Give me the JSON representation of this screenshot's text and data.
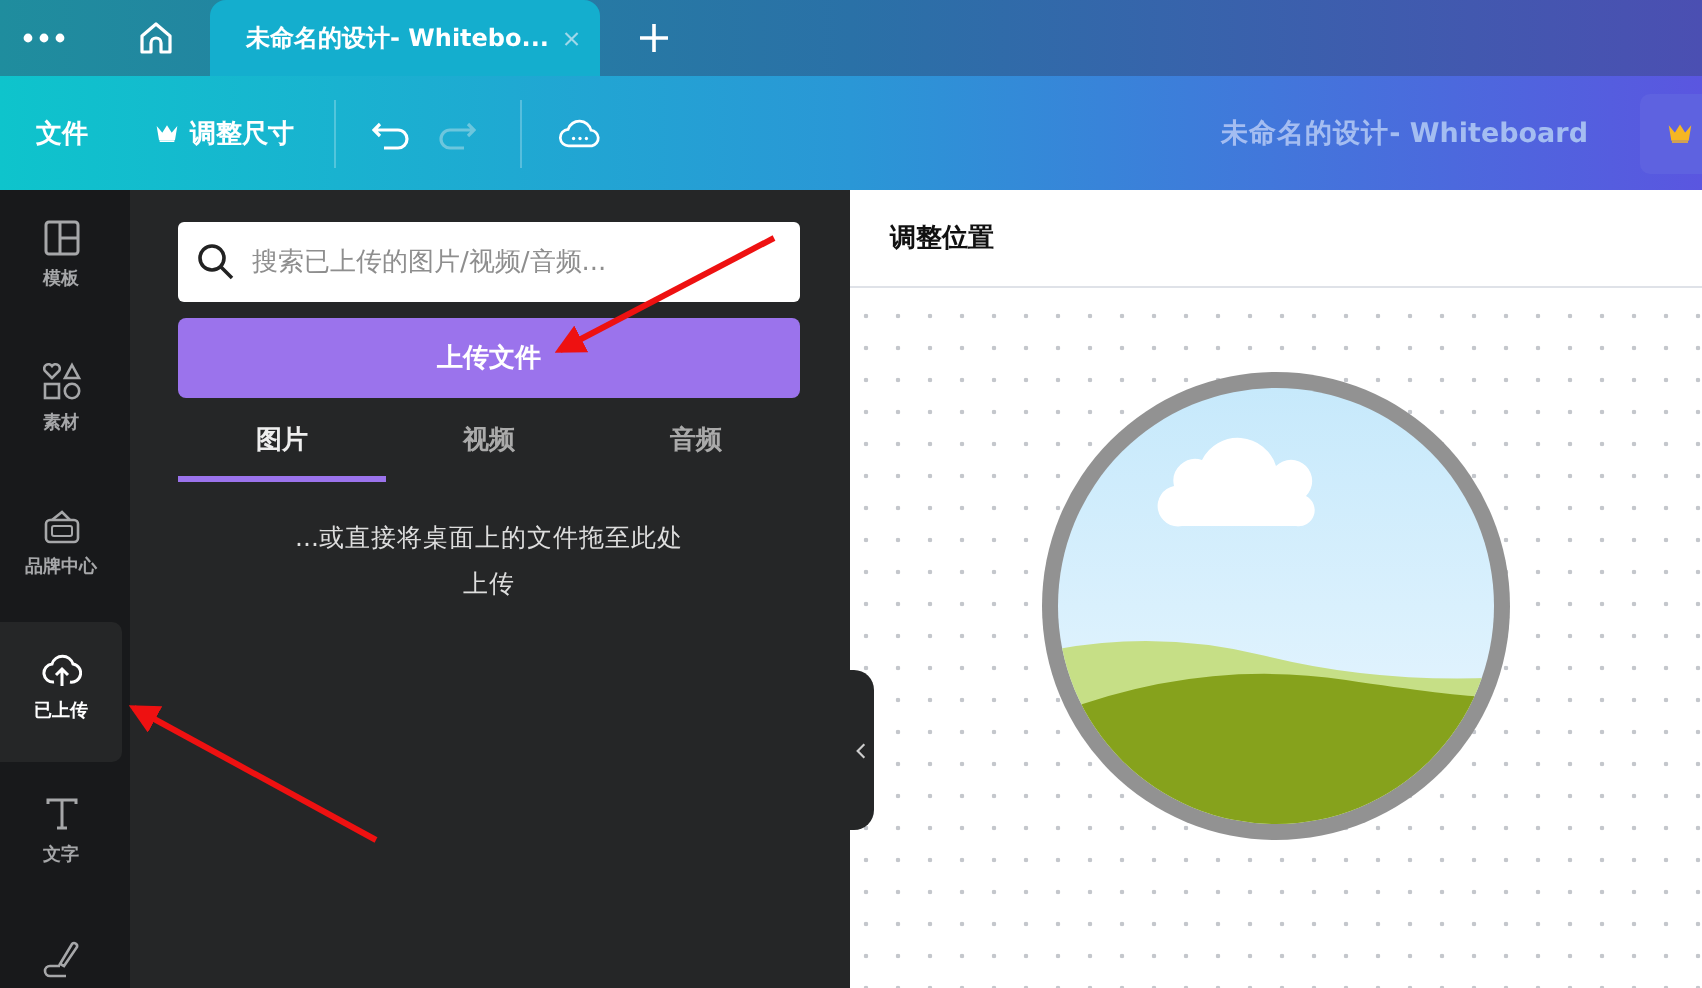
{
  "tab_bar": {
    "tabs": [
      {
        "title": "未命名的设计- Whitebo...",
        "selected": true
      }
    ]
  },
  "toolbar": {
    "file_menu": "文件",
    "resize_button": "调整尺寸",
    "undo_disabled": false,
    "redo_disabled": true,
    "document_title": "未命名的设计- Whiteboard"
  },
  "sidebar": {
    "items": [
      {
        "kind": "template",
        "label": "模板",
        "selected": false
      },
      {
        "kind": "elements",
        "label": "素材",
        "selected": false
      },
      {
        "kind": "brand",
        "label": "品牌中心",
        "selected": false
      },
      {
        "kind": "uploads",
        "label": "已上传",
        "selected": true
      },
      {
        "kind": "text",
        "label": "文字",
        "selected": false
      },
      {
        "kind": "draw",
        "selected": false
      }
    ]
  },
  "panel": {
    "search": {
      "placeholder": "搜索已上传的图片/视频/音频..."
    },
    "upload_button": "上传文件",
    "tabs": [
      {
        "label": "图片",
        "selected": true
      },
      {
        "label": "视频",
        "selected": false
      },
      {
        "label": "音频",
        "selected": false
      }
    ],
    "hint_lines": [
      "...或直接将桌面上的文件拖至此处",
      "上传"
    ]
  },
  "canvas": {
    "header": "调整位置"
  }
}
